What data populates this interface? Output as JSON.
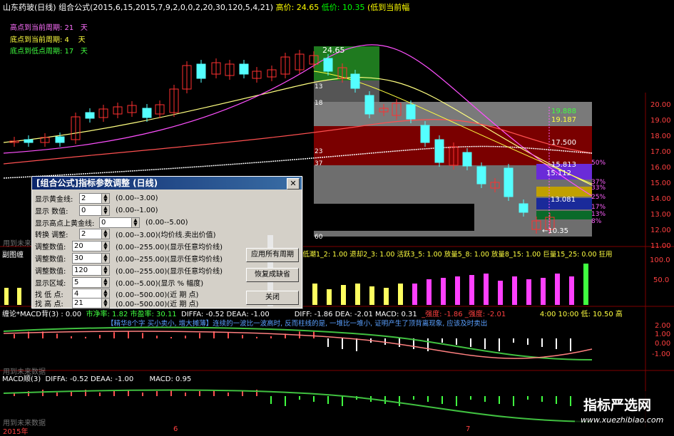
{
  "title_bar": {
    "stock": "山东药玻(日线)",
    "formula": "组合公式(2015,6,15,2015,7,9,2,0,0,2,20,30,120,5,4,21)",
    "high_label": "高价: 24.65",
    "low_label": "低价: 10.35",
    "tail": "(低到当前幅"
  },
  "info_lines": [
    {
      "label": "高点到当前周期: 21",
      "unit": "天"
    },
    {
      "label": "底点到当前周期: 4",
      "unit": "天"
    },
    {
      "label": "底点到低点周期: 17",
      "unit": "天"
    }
  ],
  "price_labels": {
    "peak": "24.65",
    "low": "10.35",
    "levels": [
      "19.888",
      "19.187",
      "17.500",
      "15.813",
      "15.112",
      "13.081"
    ],
    "pcts": [
      "50%",
      "37%",
      "33%",
      "25%",
      "17%",
      "13%",
      "8%"
    ],
    "left_ticks": [
      "13",
      "18",
      "23",
      "37",
      "60"
    ]
  },
  "y_axis": [
    "20.00",
    "19.00",
    "18.00",
    "17.00",
    "16.00",
    "15.00",
    "14.00",
    "13.00",
    "12.00",
    "11.00"
  ],
  "y_axis_vol": [
    "100.0",
    "50.0"
  ],
  "y_axis_macd1": [
    "2.00",
    "1.00",
    "0.00",
    "-1.00"
  ],
  "indicator_vol_header": {
    "left": "副图缠",
    "right": "低潮1_2: 1.00  退却2_3: 1.00  活跃3_5: 1.00  放量5_8: 1.00  放量8_15: 1.00  巨量15_25: 0.00  狂用"
  },
  "macd1_header": {
    "left": "缠论*MACD背(3) : 0.00",
    "pe": "市净率: 1.82  市盈率: 30.11",
    "diffa": "DIFFA: -0.52  DEAA: -1.00",
    "diff": "DIFF: -1.86  DEA: -2.01  MACD: 0.31",
    "strength": "_强度: -1.86  _强度: -2.01",
    "time": "4:00  10:00  低: 10.50  高"
  },
  "warning": "【精华8个字 买小卖小, 增大摊薄】连续的一波比一波高时, 反而柱线的是, 一堆比一堆小, 证明产生了顶背离现象, 应该及时卖出",
  "future_data": "用到未来数据",
  "macd2_header": {
    "left": "MACD顺(3)",
    "diffa": "DIFFA: -0.52  DEAA: -1.00",
    "macd": "MACD: 0.95"
  },
  "bottom_axis": [
    "2015年",
    "6",
    "7"
  ],
  "dialog": {
    "title": "[组合公式]指标参数调整 (日线)",
    "rows": [
      {
        "label": "显示黄金线:",
        "value": "2",
        "range": "(0.00--3.00)"
      },
      {
        "label": "显示  数值:",
        "value": "0",
        "range": "(0.00--1.00)"
      },
      {
        "label": "显示高点上黄金线:",
        "value": "0",
        "range": "(0.00--5.00)"
      },
      {
        "label": "转换  调整:",
        "value": "2",
        "range": "(0.00--3.00)(均价线.卖出价值)"
      },
      {
        "label": "调整数值:",
        "value": "20",
        "range": "(0.00--255.00)(显示任意均价线)"
      },
      {
        "label": "调整数值:",
        "value": "30",
        "range": "(0.00--255.00)(显示任意均价线)"
      },
      {
        "label": "调整数值:",
        "value": "120",
        "range": "(0.00--255.00)(显示任意均价线)"
      },
      {
        "label": "显示区域:",
        "value": "5",
        "range": "(0.00--5.00)(显示 % 幅度)"
      },
      {
        "label": "找 低 点:",
        "value": "4",
        "range": "(0.00--500.00)(近  期  点)"
      },
      {
        "label": "找 高 点:",
        "value": "21",
        "range": "(0.00--500.00)(近  期  点)"
      }
    ],
    "buttons": [
      "应用所有周期",
      "恢复成缺省",
      "关闭"
    ],
    "close_glyph": "✕"
  },
  "watermark": {
    "line1": "指标严选网",
    "line2": "www.xuezhibiao.com"
  },
  "colors": {
    "up": "#ff3030",
    "down": "#54ffff",
    "bg": "#000000"
  }
}
